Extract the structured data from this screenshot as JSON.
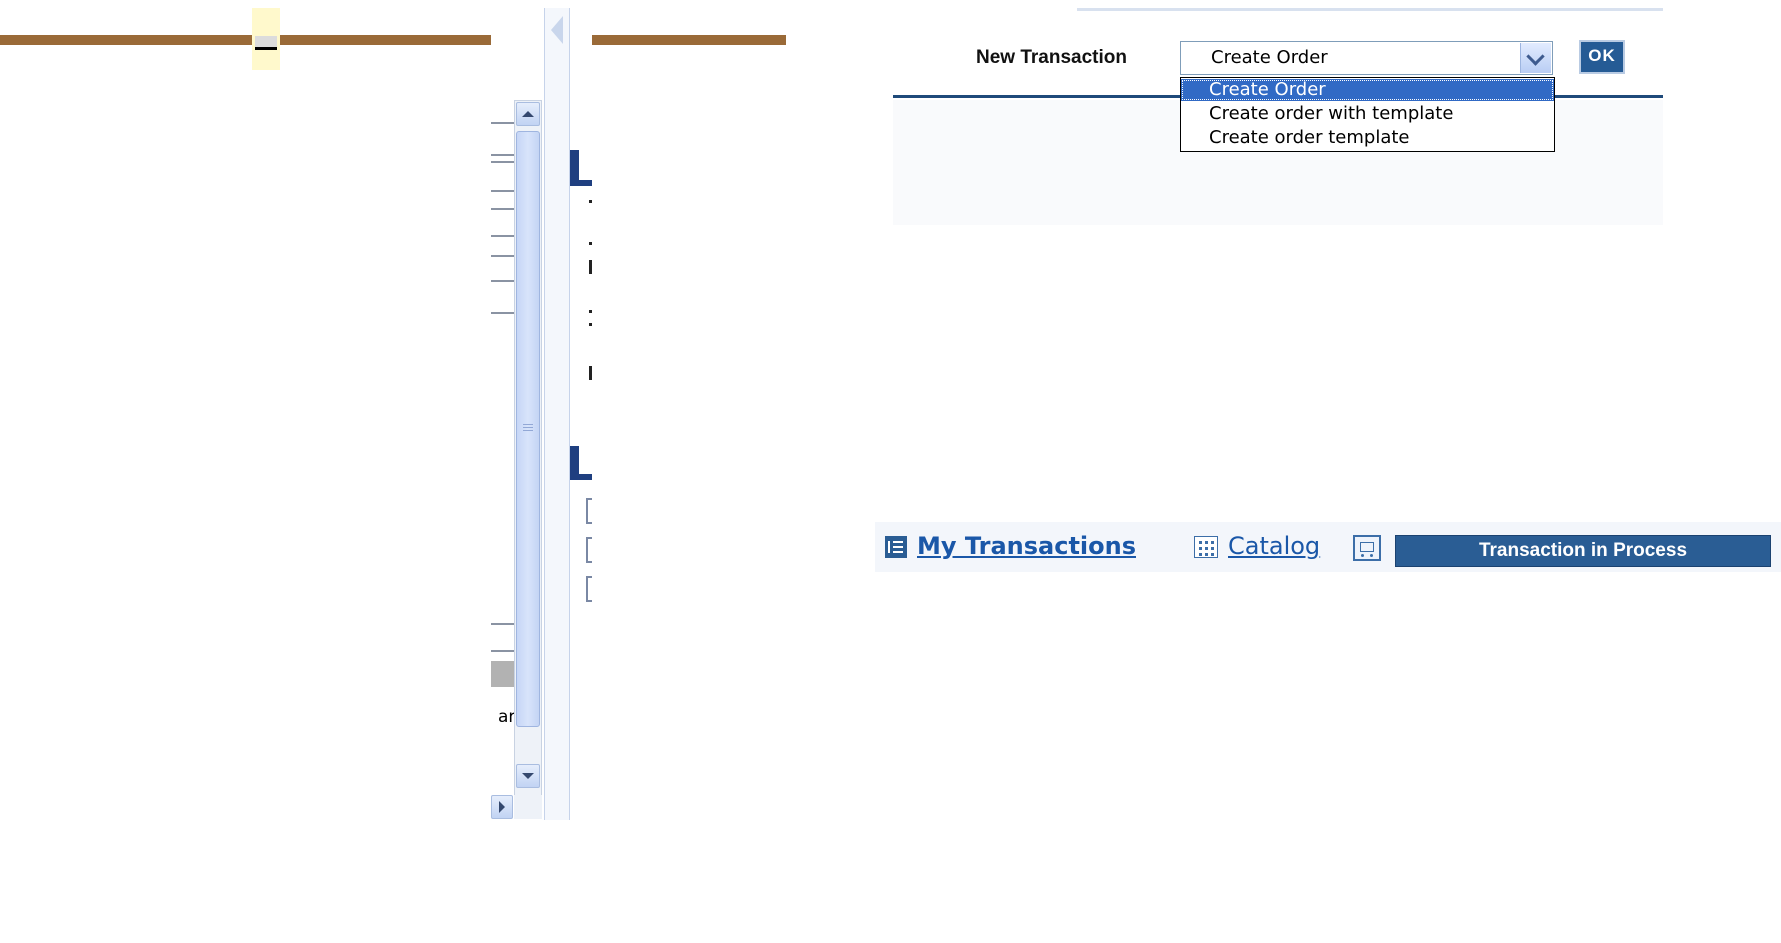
{
  "new_transaction": {
    "label": "New Transaction",
    "selected_value": "Create Order",
    "ok_label": "OK",
    "options": [
      "Create Order",
      "Create order with template",
      "Create order template"
    ]
  },
  "bottom_nav": {
    "my_transactions": "My Transactions",
    "catalog": "Catalog",
    "transaction_in_process": "Transaction in Process"
  },
  "panel": {
    "clipped_text_1": "ar"
  },
  "colors": {
    "header_brown": "#9a6a38",
    "link_blue": "#1a57a8",
    "button_navy": "#2a5d94",
    "selection_blue": "#316ac5"
  },
  "icons": [
    "minimize-icon",
    "collapse-arrow-icon",
    "scroll-up-icon",
    "scroll-down-icon",
    "scroll-right-icon",
    "dropdown-chevron-icon",
    "list-icon",
    "grid-icon",
    "cart-icon"
  ]
}
